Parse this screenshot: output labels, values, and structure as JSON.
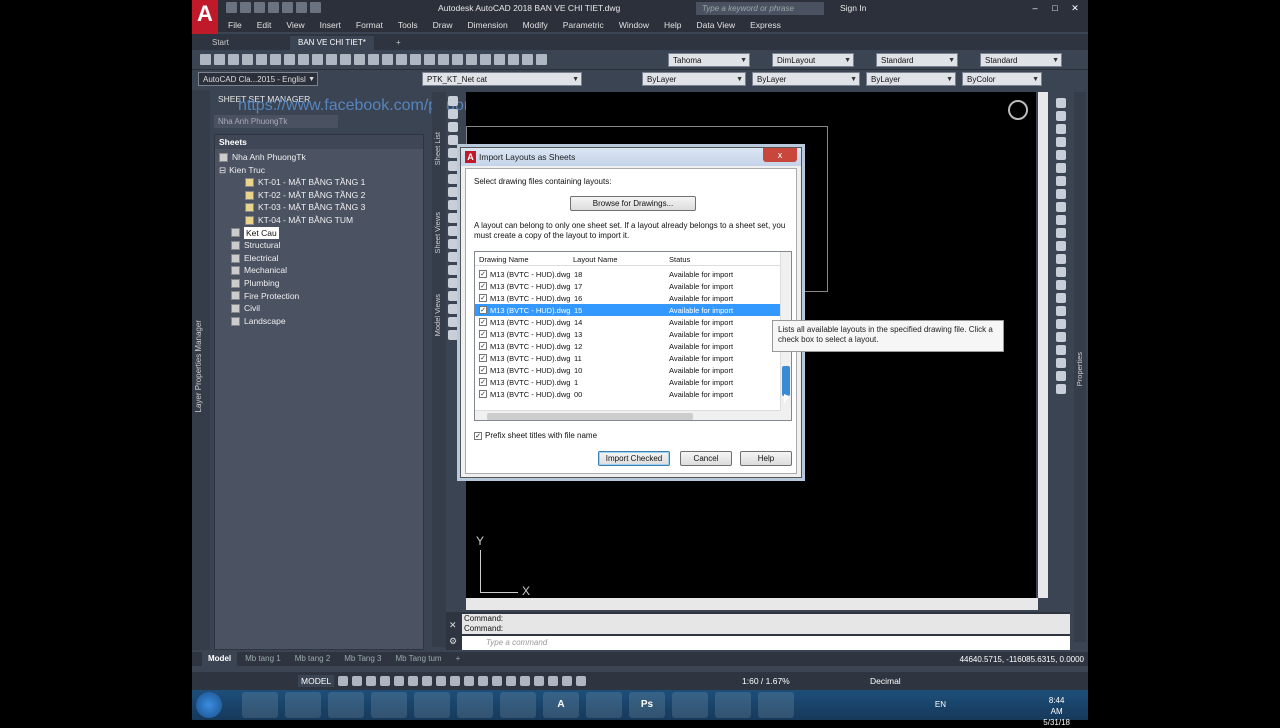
{
  "app": {
    "title": "Autodesk AutoCAD 2018   BAN VE CHI TIET.dwg",
    "search_placeholder": "Type a keyword or phrase",
    "signin": "Sign In",
    "logo": "A"
  },
  "menu": [
    "File",
    "Edit",
    "View",
    "Insert",
    "Format",
    "Tools",
    "Draw",
    "Dimension",
    "Modify",
    "Parametric",
    "Window",
    "Help",
    "Data View",
    "Express"
  ],
  "tabs": {
    "start": "Start",
    "doc": "BAN VE CHI TIET*"
  },
  "toolbar1": {
    "text_style": "Tahoma",
    "dim_style": "DimLayout",
    "table_style": "Standard",
    "mleader_style": "Standard"
  },
  "toolbar2": {
    "workspace": "AutoCAD Cla...2015 - Englisl",
    "layer": "PTK_KT_Net cat",
    "color": "ByLayer",
    "linetype": "ByLayer",
    "lineweight": "ByLayer",
    "plotstyle": "ByColor"
  },
  "sheet_set_manager": {
    "title": "SHEET SET MANAGER",
    "watermark": "https://www.facebook.com/phuong.cam",
    "sheet_set": "Nha Anh PhuongTk",
    "side_label": "Layer Properties Manager",
    "section": "Sheets",
    "tree": [
      {
        "label": "Nha Anh PhuongTk",
        "level": 0
      },
      {
        "label": "Kien Truc",
        "level": 1
      },
      {
        "label": "KT-01 - MẶT BẰNG TẦNG 1",
        "level": 2
      },
      {
        "label": "KT-02 - MẶT BẰNG TẦNG 2",
        "level": 2
      },
      {
        "label": "KT-03 - MẶT BẰNG TẦNG 3",
        "level": 2
      },
      {
        "label": "KT-04 - MẶT BẰNG TUM",
        "level": 2
      },
      {
        "label": "Ket Cau",
        "level": 1
      },
      {
        "label": "Structural",
        "level": 1
      },
      {
        "label": "Electrical",
        "level": 1
      },
      {
        "label": "Mechanical",
        "level": 1
      },
      {
        "label": "Plumbing",
        "level": 1
      },
      {
        "label": "Fire Protection",
        "level": 1
      },
      {
        "label": "Civil",
        "level": 1
      },
      {
        "label": "Landscape",
        "level": 1
      }
    ],
    "tabs": [
      "Sheet List",
      "Sheet Views",
      "Model Views"
    ]
  },
  "properties_label": "Properties",
  "ucs": {
    "x": "X",
    "y": "Y"
  },
  "dialog": {
    "title": "Import Layouts as Sheets",
    "close": "x",
    "select_label": "Select drawing files containing layouts:",
    "browse": "Browse for Drawings...",
    "info": "A layout can belong to only one sheet set. If a layout already belongs to a sheet set, you must create a copy of the layout to import it.",
    "columns": [
      "Drawing Name",
      "Layout Name",
      "Status"
    ],
    "rows": [
      {
        "drawing": "M13 (BVTC - HUD).dwg",
        "layout": "18",
        "status": "Available for import"
      },
      {
        "drawing": "M13 (BVTC - HUD).dwg",
        "layout": "17",
        "status": "Available for import"
      },
      {
        "drawing": "M13 (BVTC - HUD).dwg",
        "layout": "16",
        "status": "Available for import"
      },
      {
        "drawing": "M13 (BVTC - HUD).dwg",
        "layout": "15",
        "status": "Available for import"
      },
      {
        "drawing": "M13 (BVTC - HUD).dwg",
        "layout": "14",
        "status": "Available for import"
      },
      {
        "drawing": "M13 (BVTC - HUD).dwg",
        "layout": "13",
        "status": "Available for import"
      },
      {
        "drawing": "M13 (BVTC - HUD).dwg",
        "layout": "12",
        "status": "Available for import"
      },
      {
        "drawing": "M13 (BVTC - HUD).dwg",
        "layout": "11",
        "status": "Available for import"
      },
      {
        "drawing": "M13 (BVTC - HUD).dwg",
        "layout": "10",
        "status": "Available for import"
      },
      {
        "drawing": "M13 (BVTC - HUD).dwg",
        "layout": "1",
        "status": "Available for import"
      },
      {
        "drawing": "M13 (BVTC - HUD).dwg",
        "layout": "00",
        "status": "Available for import"
      }
    ],
    "selected_row": 3,
    "prefix_label": "Prefix sheet titles with file name",
    "import_btn": "Import Checked",
    "cancel_btn": "Cancel",
    "help_btn": "Help"
  },
  "tooltip": "Lists all available layouts in the specified drawing file. Click a check box to select a layout.",
  "command": {
    "history": [
      "Command:",
      "Command:"
    ],
    "placeholder": "Type a command"
  },
  "layout_tabs": [
    "Model",
    "Mb tang 1",
    "Mb tang 2",
    "Mb Tang 3",
    "Mb Tang tum"
  ],
  "coordinates": "44640.5715, -116085.6315, 0.0000",
  "status": {
    "model": "MODEL",
    "scale": "1:60 / 1.67%",
    "units": "Decimal"
  },
  "taskbar": {
    "lang": "EN",
    "time": "8:44 AM",
    "date": "5/31/18",
    "apps": [
      "",
      "",
      "",
      "",
      "",
      "",
      "",
      "A",
      "",
      "Ps",
      "",
      "",
      ""
    ]
  }
}
